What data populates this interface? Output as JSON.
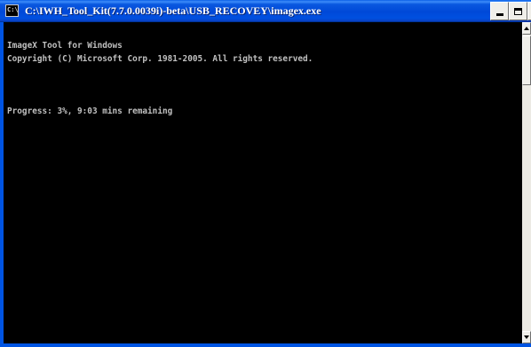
{
  "window": {
    "title": "C:\\IWH_Tool_Kit(7.7.0.0039i)-beta\\USB_RECOVEY\\imagex.exe",
    "icon": "cmd-icon",
    "icon_text": "C:\\",
    "controls": {
      "minimize": "minimize-icon",
      "maximize": "maximize-icon",
      "close": "close-icon",
      "close_glyph": "×"
    }
  },
  "console": {
    "lines": [
      "ImageX Tool for Windows",
      "Copyright (C) Microsoft Corp. 1981-2005. All rights reserved.",
      "Progress: 3%, 9:03 mins remaining"
    ],
    "background": "#000000",
    "foreground": "#c0c0c0"
  },
  "colors": {
    "titlebar": "#0054e3",
    "title_text": "#ffffff"
  }
}
